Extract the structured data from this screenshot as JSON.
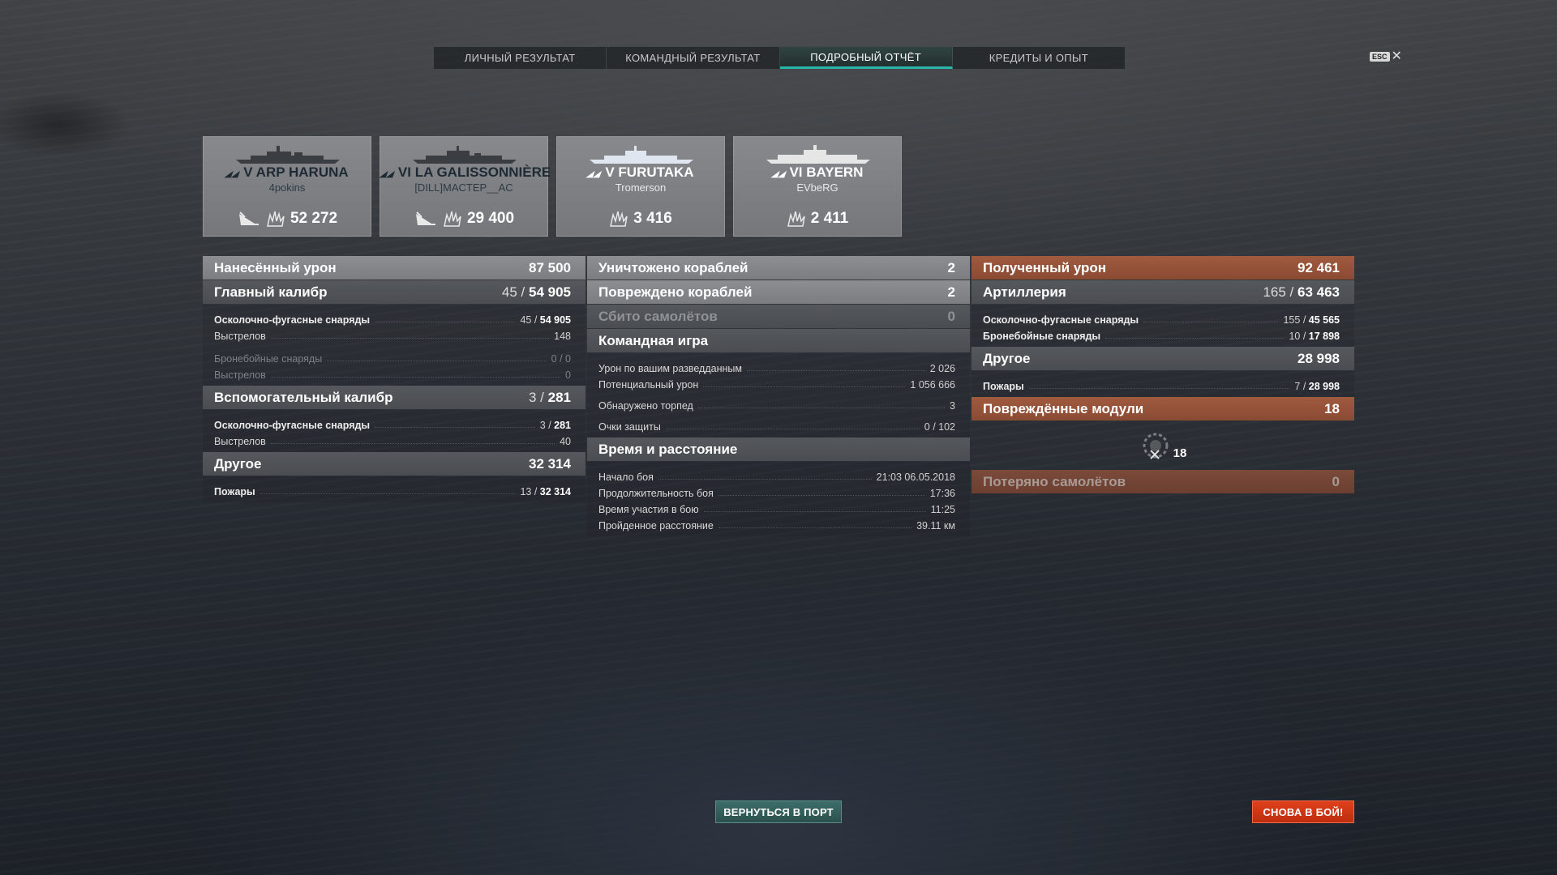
{
  "tabs": [
    {
      "label": "ЛИЧНЫЙ РЕЗУЛЬТАТ",
      "active": false
    },
    {
      "label": "КОМАНДНЫЙ РЕЗУЛЬТАТ",
      "active": false
    },
    {
      "label": "ПОДРОБНЫЙ ОТЧЁТ",
      "active": true
    },
    {
      "label": "КРЕДИТЫ И ОПЫТ",
      "active": false
    }
  ],
  "esc": {
    "key": "ESC",
    "close": "✕"
  },
  "ships": [
    {
      "name": "V ARP HARUNA",
      "player": "4pokins",
      "damage": "52 272",
      "icons": [
        "torpedo-hit-icon",
        "damage-splash-icon"
      ],
      "destroyed": true
    },
    {
      "name": "VI LA GALISSONNIÈRE",
      "player": "[DILL]MACTEP__AC",
      "damage": "29 400",
      "icons": [
        "torpedo-hit-icon",
        "damage-splash-icon"
      ],
      "destroyed": true
    },
    {
      "name": "V FURUTAKA",
      "player": "Tromerson",
      "damage": "3 416",
      "icons": [
        "damage-splash-icon"
      ],
      "destroyed": false
    },
    {
      "name": "VI BAYERN",
      "player": "EVbeRG",
      "damage": "2 411",
      "icons": [
        "damage-splash-icon"
      ],
      "destroyed": false
    }
  ],
  "dealt": {
    "title": "Нанесённый урон",
    "total": "87 500",
    "main": {
      "title": "Главный калибр",
      "hits": "45",
      "dmg": "54 905",
      "he_label": "Осколочно-фугасные снаряды",
      "he_hits": "45",
      "he_dmg": "54 905",
      "he_shots_label": "Выстрелов",
      "he_shots": "148",
      "ap_label": "Бронебойные снаряды",
      "ap_value": "0 / 0",
      "ap_shots_label": "Выстрелов",
      "ap_shots": "0"
    },
    "secondary": {
      "title": "Вспомогательный калибр",
      "hits": "3",
      "dmg": "281",
      "he_label": "Осколочно-фугасные снаряды",
      "he_hits": "3",
      "he_dmg": "281",
      "shots_label": "Выстрелов",
      "shots": "40"
    },
    "other": {
      "title": "Другое",
      "total": "32 314",
      "fires_label": "Пожары",
      "fires_count": "13",
      "fires_dmg": "32 314"
    }
  },
  "middle": {
    "destroyed_label": "Уничтожено кораблей",
    "destroyed": "2",
    "damaged_label": "Повреждено кораблей",
    "damaged": "2",
    "planes_label": "Сбито самолётов",
    "planes": "0",
    "team": {
      "title": "Командная игра",
      "rows": [
        {
          "label": "Урон по вашим разведданным",
          "value": "2 026"
        },
        {
          "label": "Потенциальный урон",
          "value": "1 056 666"
        },
        {
          "label": "Обнаружено торпед",
          "value": "3"
        },
        {
          "label": "Очки защиты",
          "value": "0 / 102"
        }
      ]
    },
    "time": {
      "title": "Время и расстояние",
      "rows": [
        {
          "label": "Начало боя",
          "value": "21:03  06.05.2018"
        },
        {
          "label": "Продолжительность боя",
          "value": "17:36"
        },
        {
          "label": "Время участия в бою",
          "value": "11:25"
        },
        {
          "label": "Пройденное расстояние",
          "value": "39.11 км"
        }
      ]
    }
  },
  "received": {
    "title": "Полученный урон",
    "total": "92 461",
    "artillery": {
      "title": "Артиллерия",
      "hits": "165",
      "dmg": "63 463",
      "he_label": "Осколочно-фугасные снаряды",
      "he_hits": "155",
      "he_dmg": "45 565",
      "ap_label": "Бронебойные снаряды",
      "ap_hits": "10",
      "ap_dmg": "17 898"
    },
    "other": {
      "title": "Другое",
      "total": "28 998",
      "fires_label": "Пожары",
      "fires_count": "7",
      "fires_dmg": "28 998"
    },
    "modules": {
      "title": "Повреждённые модули",
      "total": "18",
      "icon": "damaged-module-icon",
      "count": "18"
    },
    "planes_lost": {
      "title": "Потеряно самолётов",
      "value": "0"
    }
  },
  "buttons": {
    "port": "ВЕРНУТЬСЯ В ПОРТ",
    "fight": "СНОВА В БОЙ!"
  },
  "colors": {
    "accent_teal": "#29b6a8",
    "received_red": "#a05a3f",
    "fight_button": "#e0401c"
  }
}
